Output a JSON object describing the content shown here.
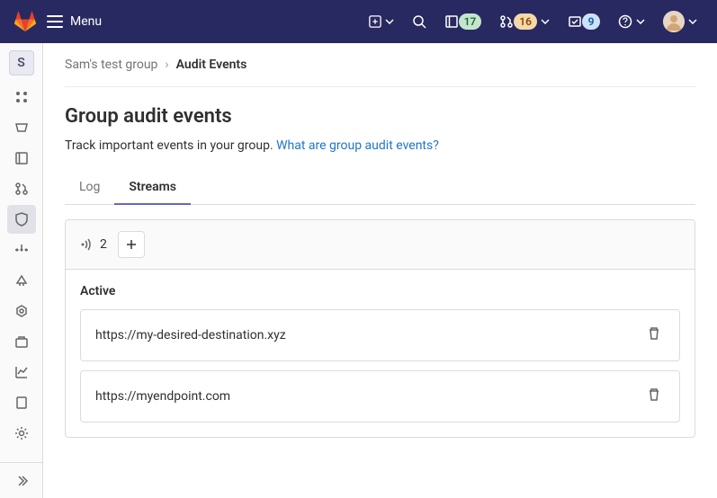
{
  "topbar": {
    "menu_label": "Menu",
    "issues_badge": "17",
    "mr_badge": "16",
    "todos_badge": "9"
  },
  "sidebar": {
    "avatar_letter": "S"
  },
  "breadcrumb": {
    "parent": "Sam's test group",
    "current": "Audit Events"
  },
  "page": {
    "title": "Group audit events",
    "desc_text": "Track important events in your group. ",
    "desc_link": "What are group audit events?"
  },
  "tabs": {
    "log": "Log",
    "streams": "Streams"
  },
  "panel": {
    "count": "2",
    "active_label": "Active",
    "streams": [
      {
        "url": "https://my-desired-destination.xyz"
      },
      {
        "url": "https://myendpoint.com"
      }
    ]
  }
}
